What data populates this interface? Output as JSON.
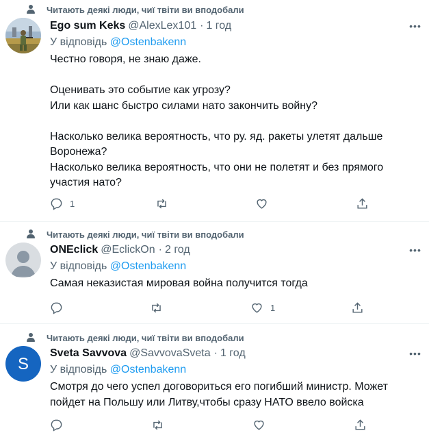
{
  "tweets": [
    {
      "social_context": "Читають деякі люди, чиї твіти ви вподобали",
      "name": "Ego sum Keks",
      "handle": "@AlexLex101",
      "dot": "·",
      "time": "1 год",
      "reply_prefix": "У відповідь",
      "reply_to": "@Ostenbakenn",
      "body": "Честно говоря, не знаю даже.\n\nОценивать это событие как угрозу?\nИли как шанс быстро силами нато закончить войну?\n\nНасколько велика вероятность, что ру. яд. ракеты улетят дальше Воронежа?\nНасколько велика вероятность, что они не полетят и без прямого участия нато?",
      "avatar_icon": "soldier-photo-avatar",
      "reply_count": "1",
      "retweet_count": "",
      "like_count": ""
    },
    {
      "social_context": "Читають деякі люди, чиї твіти ви вподобали",
      "name": "ONEclick",
      "handle": "@EclickOn",
      "dot": "·",
      "time": "2 год",
      "reply_prefix": "У відповідь",
      "reply_to": "@Ostenbakenn",
      "body": "Самая неказистая мировая война получится тогда",
      "avatar_icon": "default-person-avatar",
      "reply_count": "",
      "retweet_count": "",
      "like_count": "1"
    },
    {
      "social_context": "Читають деякі люди, чиї твіти ви вподобали",
      "name": "Sveta Savvova",
      "handle": "@SavvovaSveta",
      "dot": "·",
      "time": "1 год",
      "reply_prefix": "У відповідь",
      "reply_to": "@Ostenbakenn",
      "body": "Смотря до чего успел договориться его погибший министр. Может пойдет на Польшу или Литву,чтобы сразу НАТО ввело войска",
      "avatar_letter": "S",
      "avatar_color": "#1565c0",
      "reply_count": "",
      "retweet_count": "",
      "like_count": ""
    }
  ],
  "colors": {
    "text_primary": "#0f1419",
    "text_secondary": "#536471",
    "link": "#1d9bf0",
    "divider": "#eff3f4"
  },
  "icons": [
    "person-icon",
    "reply-icon",
    "retweet-icon",
    "like-icon",
    "share-icon",
    "more-icon"
  ]
}
